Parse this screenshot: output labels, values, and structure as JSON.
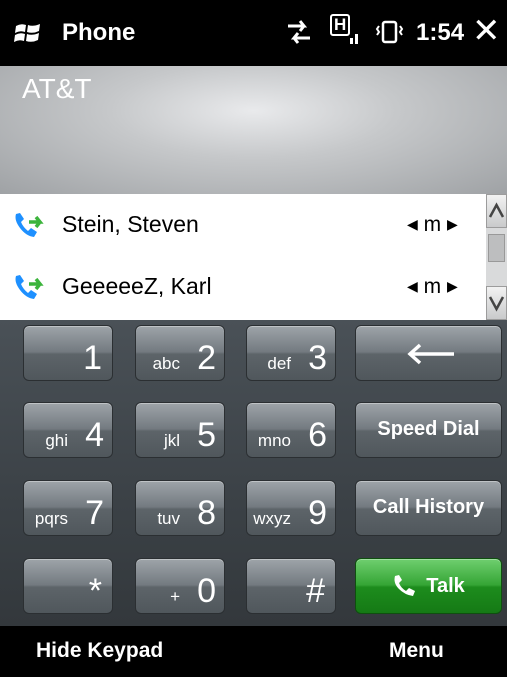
{
  "titlebar": {
    "app_title": "Phone",
    "clock": "1:54",
    "network_indicator": "H"
  },
  "carrier": {
    "name": "AT&T"
  },
  "suggestions": [
    {
      "name": "Stein, Steven",
      "type_label": "m"
    },
    {
      "name": "GeeeeeZ, Karl",
      "type_label": "m"
    }
  ],
  "keypad": {
    "keys": [
      {
        "letters": "",
        "digit": "1"
      },
      {
        "letters": "abc",
        "digit": "2"
      },
      {
        "letters": "def",
        "digit": "3"
      },
      {
        "letters": "ghi",
        "digit": "4"
      },
      {
        "letters": "jkl",
        "digit": "5"
      },
      {
        "letters": "mno",
        "digit": "6"
      },
      {
        "letters": "pqrs",
        "digit": "7"
      },
      {
        "letters": "tuv",
        "digit": "8"
      },
      {
        "letters": "wxyz",
        "digit": "9"
      },
      {
        "letters": "",
        "digit": "*"
      },
      {
        "letters": "+",
        "digit": "0"
      },
      {
        "letters": "",
        "digit": "#"
      }
    ],
    "speed_dial_label": "Speed Dial",
    "call_history_label": "Call History",
    "talk_label": "Talk"
  },
  "softkeys": {
    "left": "Hide Keypad",
    "right": "Menu"
  },
  "icons": {
    "windows": "windows-logo-icon",
    "sync": "sync-arrows-icon",
    "signal": "signal-icon",
    "vibrate": "vibrate-icon",
    "close": "close-icon",
    "call": "phone-call-icon",
    "backspace": "backspace-arrow-icon"
  },
  "colors": {
    "talk_green": "#2e9e2e",
    "key_gray": "#6b7277",
    "call_icon_blue": "#1e90ff",
    "call_icon_green": "#3cb43c"
  }
}
